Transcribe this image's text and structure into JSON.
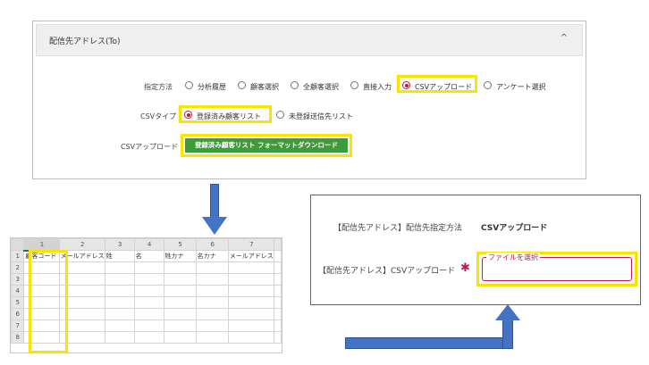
{
  "panel": {
    "title": "配信先アドレス(To)",
    "collapse_icon": "chevron-up-icon",
    "method": {
      "label": "指定方法",
      "options": [
        "分析履歴",
        "顧客選択",
        "全顧客選択",
        "直接入力",
        "CSVアップロード",
        "アンケート選択"
      ],
      "selected": "CSVアップロード"
    },
    "csv_type": {
      "label": "CSVタイプ",
      "options": [
        "登録済み顧客リスト",
        "未登録送信先リスト"
      ],
      "selected": "登録済み顧客リスト"
    },
    "csv_upload": {
      "label": "CSVアップロード",
      "button_label": "登録済み顧客リスト フォーマットダウンロード"
    }
  },
  "sheet": {
    "col_headers": [
      "1",
      "2",
      "3",
      "4",
      "5",
      "6",
      "7"
    ],
    "row_headers": [
      "1",
      "2",
      "3",
      "4",
      "5",
      "6",
      "7",
      "8"
    ],
    "row1": [
      "顧客コード",
      "メールアドレス",
      "姓",
      "名",
      "姓カナ",
      "名カナ",
      "メールアドレス"
    ]
  },
  "form": {
    "method_label": "【配信先アドレス】配信先指定方法",
    "method_value": "CSVアップロード",
    "upload_label": "【配信先アドレス】CSVアップロード",
    "required_mark": "✱",
    "file_placeholder": "ファイルを選択"
  },
  "colors": {
    "highlight": "#f7e400",
    "accent": "#b71c2c",
    "button_green": "#3e9b3a",
    "arrow_blue": "#4472c4"
  }
}
